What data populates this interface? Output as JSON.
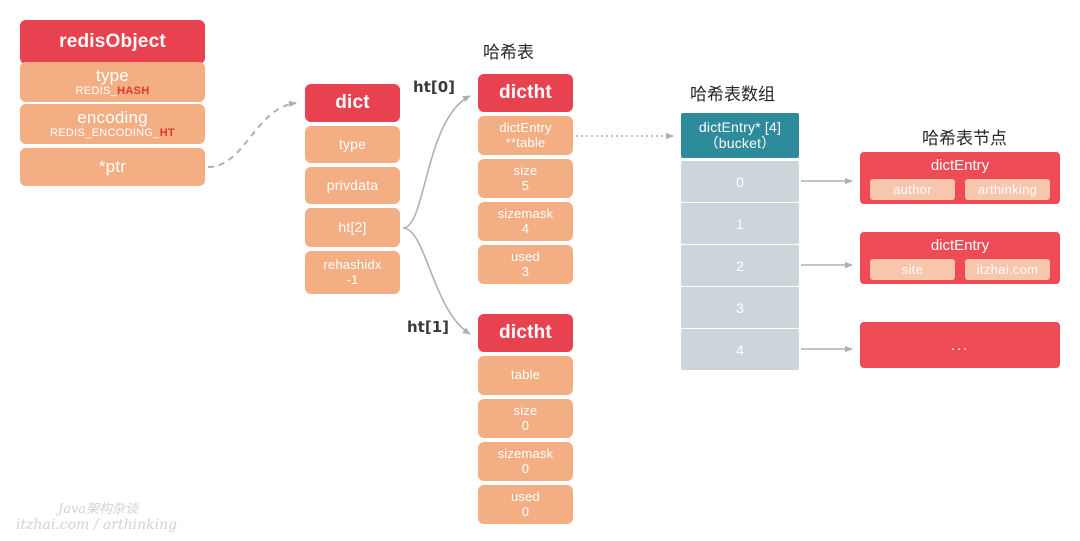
{
  "diagram": {
    "captions": {
      "hash_table": "哈希表",
      "bucket_array": "哈希表数组",
      "hash_node": "哈希表节点"
    },
    "edge_labels": {
      "ht0": "ht[0]",
      "ht1": "ht[1]"
    }
  },
  "redis_object": {
    "title": "redisObject",
    "fields": [
      {
        "name": "type",
        "prefix": "REDIS_",
        "highlight": "HASH"
      },
      {
        "name": "encoding",
        "prefix": "REDIS_ENCODING_",
        "highlight": "HT"
      },
      {
        "name": "*ptr",
        "prefix": "",
        "highlight": ""
      }
    ]
  },
  "dict": {
    "title": "dict",
    "fields": [
      {
        "name": "type",
        "value": ""
      },
      {
        "name": "privdata",
        "value": ""
      },
      {
        "name": "ht[2]",
        "value": ""
      },
      {
        "name": "rehashidx",
        "value": "-1"
      }
    ]
  },
  "dictht0": {
    "title": "dictht",
    "fields": [
      {
        "name": "dictEntry",
        "name2": "**table",
        "value": ""
      },
      {
        "name": "size",
        "value": "5"
      },
      {
        "name": "sizemask",
        "value": "4"
      },
      {
        "name": "used",
        "value": "3"
      }
    ]
  },
  "dictht1": {
    "title": "dictht",
    "fields": [
      {
        "name": "table",
        "value": ""
      },
      {
        "name": "size",
        "value": "0"
      },
      {
        "name": "sizemask",
        "value": "0"
      },
      {
        "name": "used",
        "value": "0"
      }
    ]
  },
  "bucket": {
    "header_line1": "dictEntry* [4]",
    "header_line2": "（bucket）",
    "cells": [
      "0",
      "1",
      "2",
      "3",
      "4"
    ]
  },
  "nodes": [
    {
      "title": "dictEntry",
      "key": "author",
      "value": "arthinking"
    },
    {
      "title": "dictEntry",
      "key": "site",
      "value": "itzhai.com"
    },
    {
      "title": "",
      "key": "",
      "value": "",
      "placeholder": "..."
    }
  ],
  "watermark": {
    "line1": "Java架构杂谈",
    "line2": "itzhai.com / arthinking"
  },
  "colors": {
    "red": "#e8414f",
    "node_red": "#ef4b55",
    "salmon": "#f3ae84",
    "pill": "#f7c6ac",
    "teal": "#2e8b9b",
    "bucket_gray": "#ccd6da",
    "arrow": "#a9b2b8",
    "highlight_text": "#e0392b"
  }
}
